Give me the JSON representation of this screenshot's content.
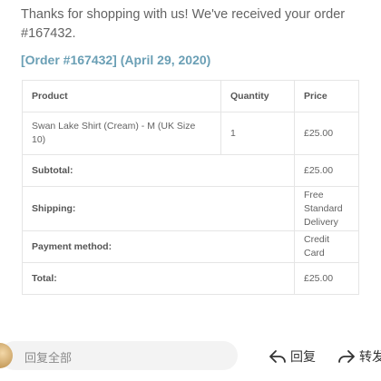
{
  "email": {
    "intro": "Thanks for shopping with us! We've received your order #167432.",
    "order_heading": "[Order #167432] (April 29, 2020)"
  },
  "table": {
    "headers": {
      "product": "Product",
      "quantity": "Quantity",
      "price": "Price"
    },
    "items": [
      {
        "product": "Swan Lake Shirt (Cream) - M (UK Size 10)",
        "quantity": "1",
        "price": "£25.00"
      }
    ],
    "totals": [
      {
        "label": "Subtotal:",
        "value": "£25.00"
      },
      {
        "label": "Shipping:",
        "value": "Free Standard Delivery"
      },
      {
        "label": "Payment method:",
        "value": "Credit Card"
      },
      {
        "label": "Total:",
        "value": "£25.00"
      }
    ]
  },
  "bottom_bar": {
    "reply_all": "回复全部",
    "reply": "回复",
    "forward": "转发"
  },
  "colors": {
    "link": "#6a9fb5",
    "border": "#e5e5e5"
  }
}
